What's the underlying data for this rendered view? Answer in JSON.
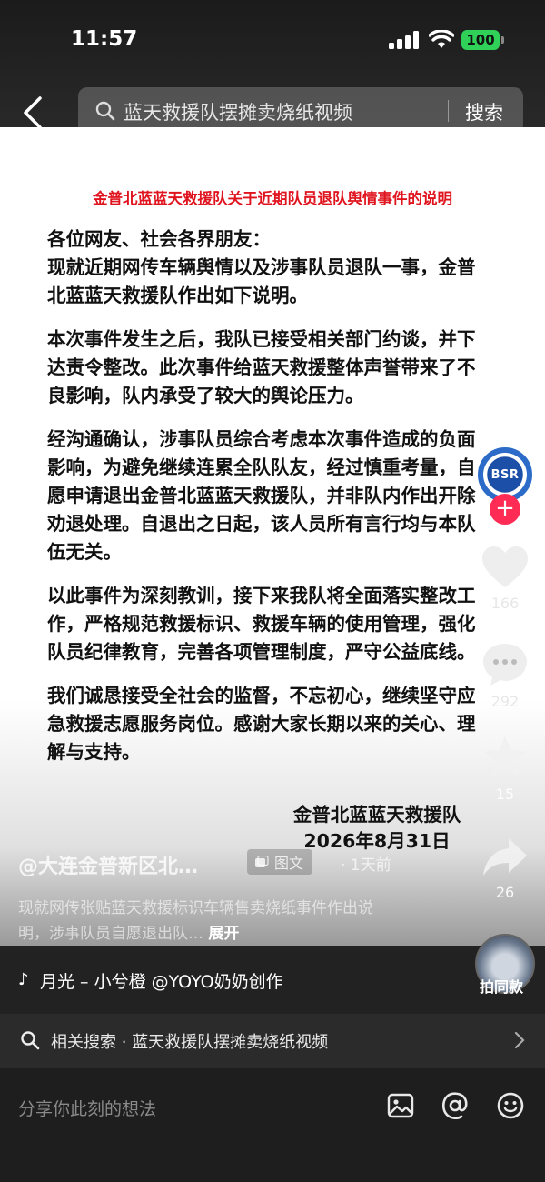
{
  "status_bar": {
    "time": "11:57",
    "battery": "100"
  },
  "search": {
    "query": "蓝天救援队摆摊卖烧纸视频",
    "button_label": "搜索"
  },
  "document": {
    "title": "金普北蓝蓝天救援队关于近期队员退队舆情事件的说明",
    "paragraphs": [
      "各位网友、社会各界朋友：\n现就近期网传车辆舆情以及涉事队员退队一事，金普北蓝蓝天救援队作出如下说明。",
      "本次事件发生之后，我队已接受相关部门约谈，并下达责令整改。此次事件给蓝天救援整体声誉带来了不良影响，队内承受了较大的舆论压力。",
      "经沟通确认，涉事队员综合考虑本次事件造成的负面影响，为避免继续连累全队队友，经过慎重考量，自愿申请退出金普北蓝蓝天救援队，并非队内作出开除劝退处理。自退出之日起，该人员所有言行均与本队伍无关。",
      "以此事件为深刻教训，接下来我队将全面落实整改工作，严格规范救援标识、救援车辆的使用管理，强化队员纪律教育，完善各项管理制度，严守公益底线。",
      "我们诚恳接受全社会的监督，不忘初心，继续坚守应急救援志愿服务岗位。感谢大家长期以来的关心、理解与支持。"
    ],
    "signature": "金普北蓝蓝天救援队",
    "date": "2026年8月31日"
  },
  "actions": {
    "avatar_text": "BSR",
    "follow": "+",
    "likes": "166",
    "comments": "292",
    "favorites": "15",
    "shares": "26"
  },
  "caption": {
    "author": "@大连金普新区北…",
    "tag": "图文",
    "time": "· 1天前",
    "description": "现就网传张贴蓝天救援标识车辆售卖烧纸事件作出说明，涉事队员自愿退出队…",
    "expand": "展开"
  },
  "music": {
    "text": "月光 – 小兮橙 @YOYO奶奶创作",
    "same_label": "拍同款"
  },
  "related": {
    "text": "相关搜索 · 蓝天救援队摆摊卖烧纸视频"
  },
  "comment_bar": {
    "placeholder": "分享你此刻的想法"
  },
  "icons": [
    "back-icon",
    "search-icon",
    "heart-icon",
    "comment-icon",
    "star-icon",
    "share-icon",
    "image-icon",
    "at-icon",
    "emoji-icon",
    "chevron-right-icon",
    "music-note-icon"
  ],
  "colors": {
    "title_red": "#e0141e",
    "follow_pink": "#fe2c55",
    "battery_green": "#2fd158"
  }
}
